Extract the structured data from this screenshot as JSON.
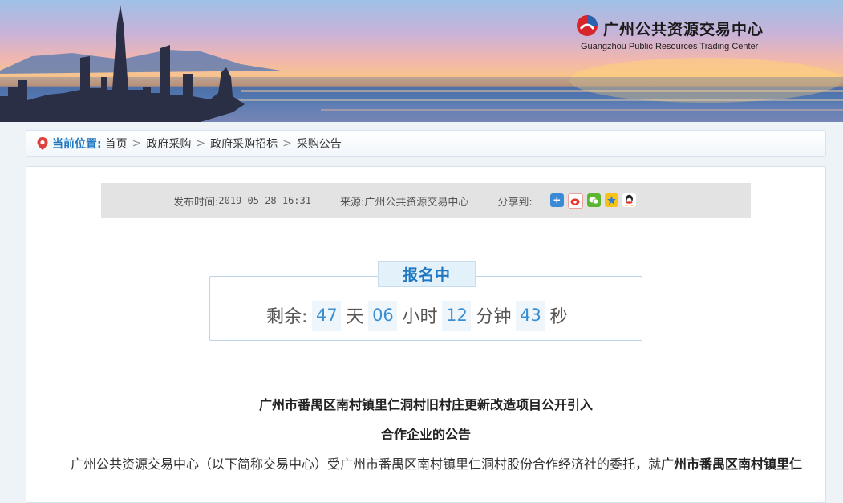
{
  "header": {
    "logo_title": "广州公共资源交易中心",
    "logo_subtitle": "Guangzhou Public Resources Trading Center"
  },
  "breadcrumb": {
    "label": "当前位置:",
    "items": [
      "首页",
      "政府采购",
      "政府采购招标",
      "采购公告"
    ],
    "separator": ">"
  },
  "meta": {
    "publish_label": "发布时间:",
    "publish_time": "2019-05-28 16:31",
    "source_label": "来源:",
    "source": "广州公共资源交易中心",
    "share_label": "分享到:",
    "share_icons": [
      "share-plus-icon",
      "weibo-icon",
      "wechat-icon",
      "qzone-icon",
      "qq-icon"
    ]
  },
  "countdown": {
    "status": "报名中",
    "prefix": "剩余:",
    "days": "47",
    "days_unit": "天",
    "hours": "06",
    "hours_unit": "小时",
    "minutes": "12",
    "minutes_unit": "分钟",
    "seconds": "43",
    "seconds_unit": "秒"
  },
  "article": {
    "title_line1": "广州市番禺区南村镇里仁洞村旧村庄更新改造项目公开引入",
    "title_line2": "合作企业的公告",
    "body_start": "广州公共资源交易中心（以下简称交易中心）受广州市番禺区南村镇里仁洞村股份合作经济社的委托，就",
    "body_bold": "广州市番禺区南村镇里仁"
  },
  "colors": {
    "accent": "#1f77c1",
    "countdown_number": "#3c8ed0"
  }
}
